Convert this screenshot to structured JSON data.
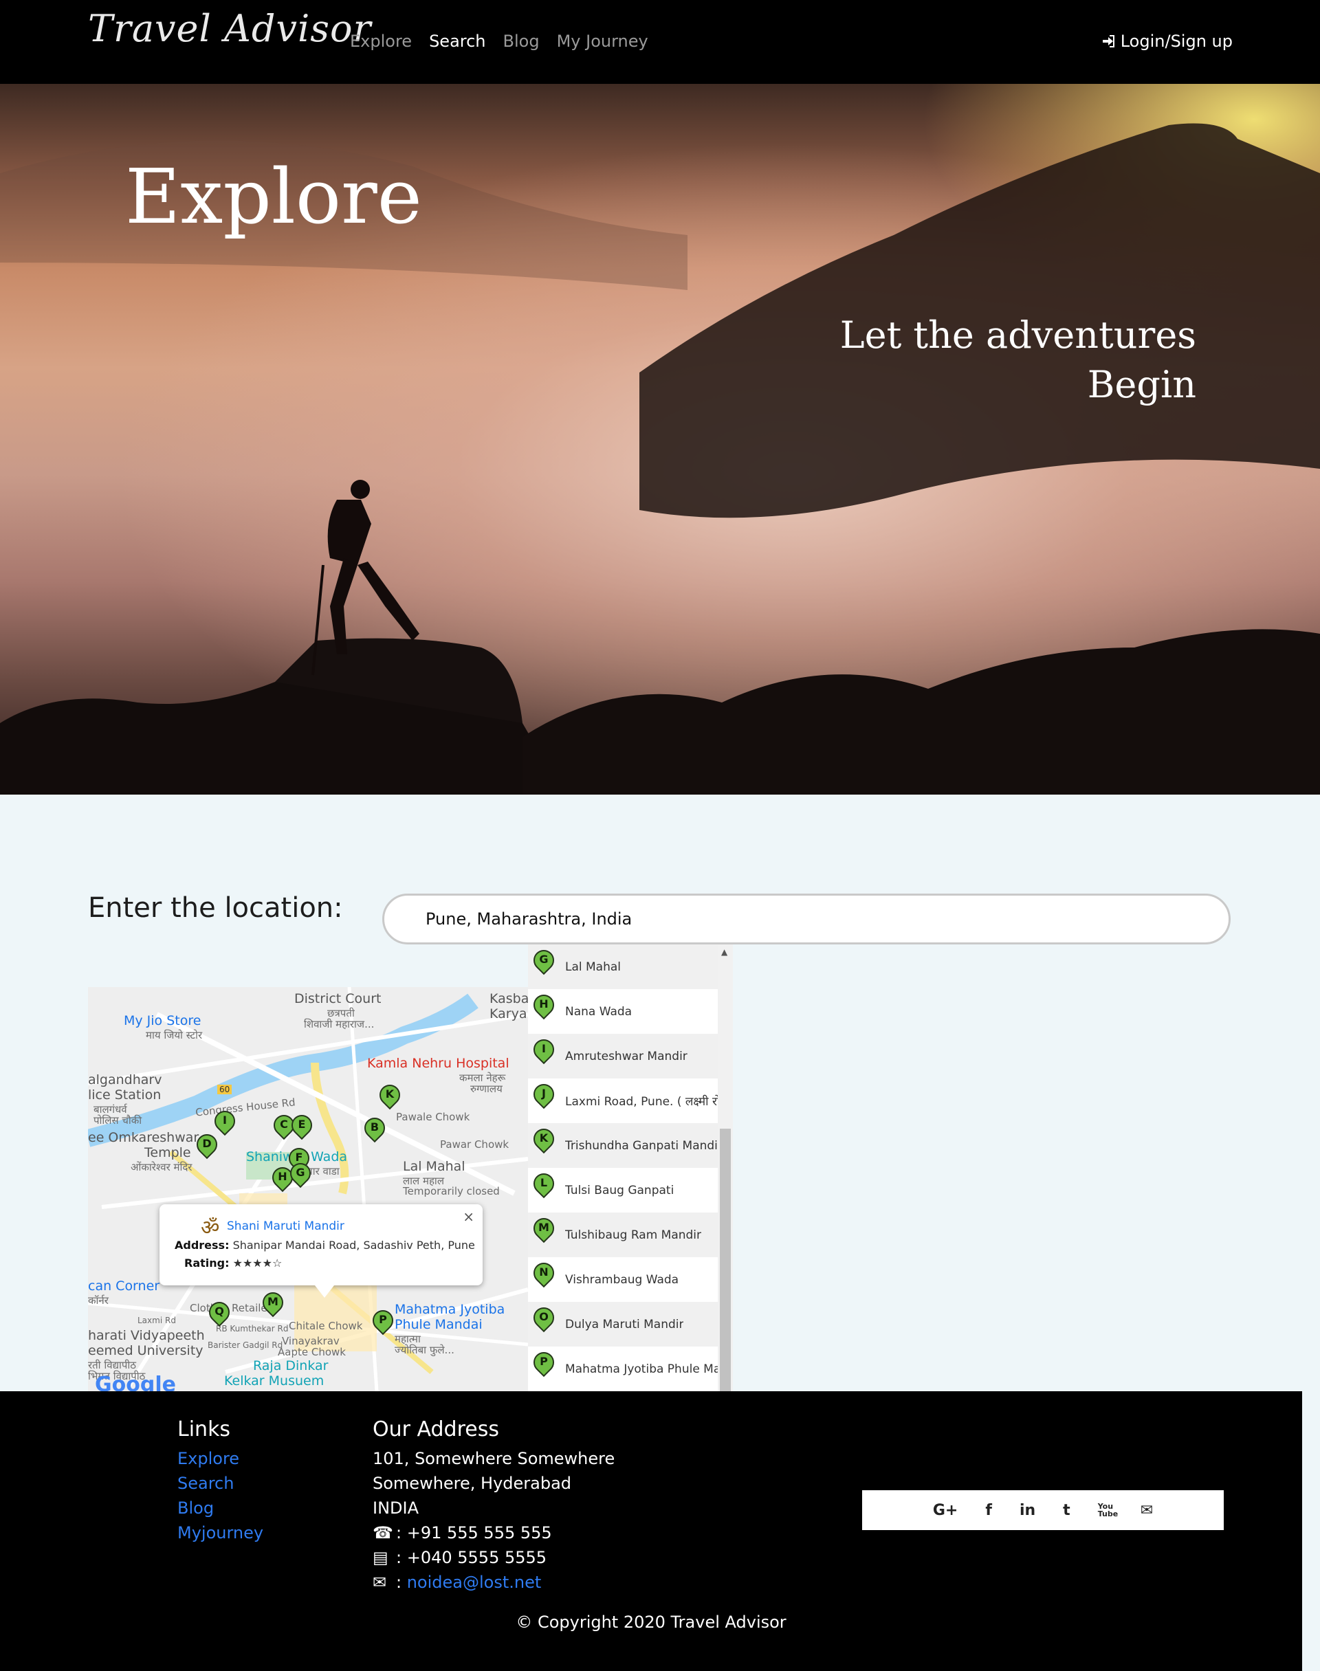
{
  "navbar": {
    "brand": "Travel Advisor",
    "links": [
      "Explore",
      "Search",
      "Blog",
      "My Journey"
    ],
    "login": "Login/Sign up"
  },
  "hero": {
    "title": "Explore",
    "subtitle_line1": "Let the adventures",
    "subtitle_line2": "Begin"
  },
  "search": {
    "label": "Enter the location:",
    "value": "Pune, Maharashtra, India"
  },
  "map": {
    "labels": {
      "district_court": "District Court",
      "chhatrapati": "छत्रपती",
      "shivaji": "शिवाजी महाराज...",
      "kasba": "Kasba",
      "karyal": "Karyal",
      "jio": "My Jio Store",
      "jio_sub": "माय जियो स्टोर",
      "kamla": "Kamla Nehru Hospital",
      "kamla_sub": "कमला नेहरू",
      "kamla_sub2": "रुग्णालय",
      "gandharv": "algandharv",
      "police": "lice Station",
      "police_sub": "बालगंधर्व",
      "police_sub2": "पोलिस चौकी",
      "congress": "Congress House Rd",
      "pawale": "Pawale Chowk",
      "omkareshwar": "ee Omkareshwar",
      "temple": "Temple",
      "temple_sub": "ओंकारेश्वर मंदिर",
      "shaniwar": "Shaniwar Wada",
      "shaniwar_sub": "शनिवार वाडा",
      "pawar": "Pawar Chowk",
      "lalmahal": "Lal Mahal",
      "lalmahal_sub": "लाल महाल",
      "closed": "Temporarily closed",
      "corner": "can Corner",
      "corner_sub": "कॉर्नर",
      "clothes": "Clothes Retailer",
      "laxmi": "Laxmi Rd",
      "kumthekar": "RB Kumthekar Rd",
      "chitale": "Chitale Chowk",
      "vidyapeeth": "harati Vidyapeeth",
      "deemed": "eemed University",
      "vidya_sub": "रती विद्यापीठ",
      "vidya_sub2": "भिमत विद्यापीठ",
      "baristar": "Barister Gadgil Rd",
      "vinayakrav": "Vinayakrav",
      "aapte": "Aapte Chowk",
      "mahatma": "Mahatma Jyotiba",
      "phule": "Phule Mandai",
      "mahatma_sub": "महात्मा",
      "mahatma_sub2": "ज्योतिबा फुले...",
      "raja": "Raja Dinkar",
      "kelkar": "Kelkar Musuem",
      "google": "Google",
      "road_60": "60"
    },
    "info": {
      "name": "Shani Maruti Mandir",
      "address_label": "Address:",
      "address": "Shanipar Mandai Road, Sadashiv Peth, Pune",
      "rating_label": "Rating:",
      "rating": "★★★★☆"
    }
  },
  "places": [
    {
      "letter": "G",
      "name": "Lal Mahal"
    },
    {
      "letter": "H",
      "name": "Nana Wada"
    },
    {
      "letter": "I",
      "name": "Amruteshwar Mandir"
    },
    {
      "letter": "J",
      "name": "Laxmi Road, Pune. ( लक्ष्मी रोड"
    },
    {
      "letter": "K",
      "name": "Trishundha Ganpati Mandir"
    },
    {
      "letter": "L",
      "name": "Tulsi Baug Ganpati"
    },
    {
      "letter": "M",
      "name": "Tulshibaug Ram Mandir"
    },
    {
      "letter": "N",
      "name": "Vishrambaug Wada"
    },
    {
      "letter": "O",
      "name": "Dulya Maruti Mandir"
    },
    {
      "letter": "P",
      "name": "Mahatma Jyotiba Phule Mandai"
    }
  ],
  "footer": {
    "links_heading": "Links",
    "links": [
      "Explore",
      "Search",
      "Blog",
      "Myjourney"
    ],
    "address_heading": "Our Address",
    "address_lines": [
      "101, Somewhere Somewhere",
      "Somewhere, Hyderabad",
      "INDIA"
    ],
    "phone": ": +91 555 555 555",
    "fax": ": +040 5555 5555",
    "email": "noidea@lost.net",
    "social": [
      "G+",
      "f",
      "in",
      "t",
      "You Tube",
      "✉"
    ],
    "copyright": "© Copyright 2020 Travel Advisor"
  }
}
